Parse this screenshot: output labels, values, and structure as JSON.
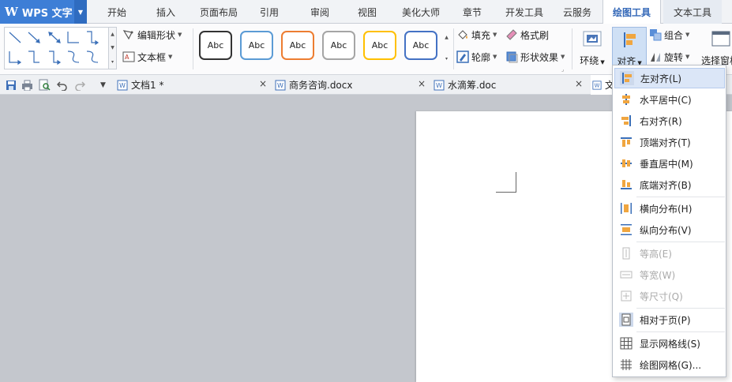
{
  "app": {
    "title": "WPS 文字"
  },
  "menu_tabs": [
    "开始",
    "插入",
    "页面布局",
    "引用",
    "审阅",
    "视图",
    "美化大师",
    "章节",
    "开发工具",
    "云服务",
    "绘图工具",
    "文本工具"
  ],
  "ribbon": {
    "edit_shape": "编辑形状",
    "text_box": "文本框",
    "style_label": "Abc",
    "fill": "填充",
    "format_painter": "格式刷",
    "outline": "轮廓",
    "shape_effects": "形状效果",
    "wrap": "环绕",
    "align": "对齐",
    "group": "组合",
    "rotate": "旋转",
    "selection_pane": "选择窗格"
  },
  "doc_tabs": [
    "文档1 *",
    "商务咨询.docx",
    "水滴筹.doc",
    "文"
  ],
  "align_menu": [
    {
      "label": "左对齐(L)",
      "icon": "align-left-icon"
    },
    {
      "label": "水平居中(C)",
      "icon": "align-center-horizontal-icon"
    },
    {
      "label": "右对齐(R)",
      "icon": "align-right-icon"
    },
    {
      "label": "顶端对齐(T)",
      "icon": "align-top-icon"
    },
    {
      "label": "垂直居中(M)",
      "icon": "align-middle-vertical-icon"
    },
    {
      "label": "底端对齐(B)",
      "icon": "align-bottom-icon"
    },
    {
      "label": "横向分布(H)",
      "icon": "distribute-horizontal-icon"
    },
    {
      "label": "纵向分布(V)",
      "icon": "distribute-vertical-icon"
    },
    {
      "label": "等高(E)",
      "icon": "same-height-icon"
    },
    {
      "label": "等宽(W)",
      "icon": "same-width-icon"
    },
    {
      "label": "等尺寸(Q)",
      "icon": "same-size-icon"
    },
    {
      "label": "相对于页(P)",
      "icon": "relative-to-page-icon"
    },
    {
      "label": "显示网格线(S)",
      "icon": "show-gridlines-icon"
    },
    {
      "label": "绘图网格(G)...",
      "icon": "drawing-grid-icon"
    }
  ],
  "colors": {
    "brand_blue": "#3d7ed6",
    "accent_orange": "#f0a640",
    "highlight": "#dbe6f7",
    "style_borders": [
      "#333333",
      "#5b9bd5",
      "#ed7d31",
      "#a5a5a5",
      "#ffc000",
      "#4472c4"
    ]
  }
}
